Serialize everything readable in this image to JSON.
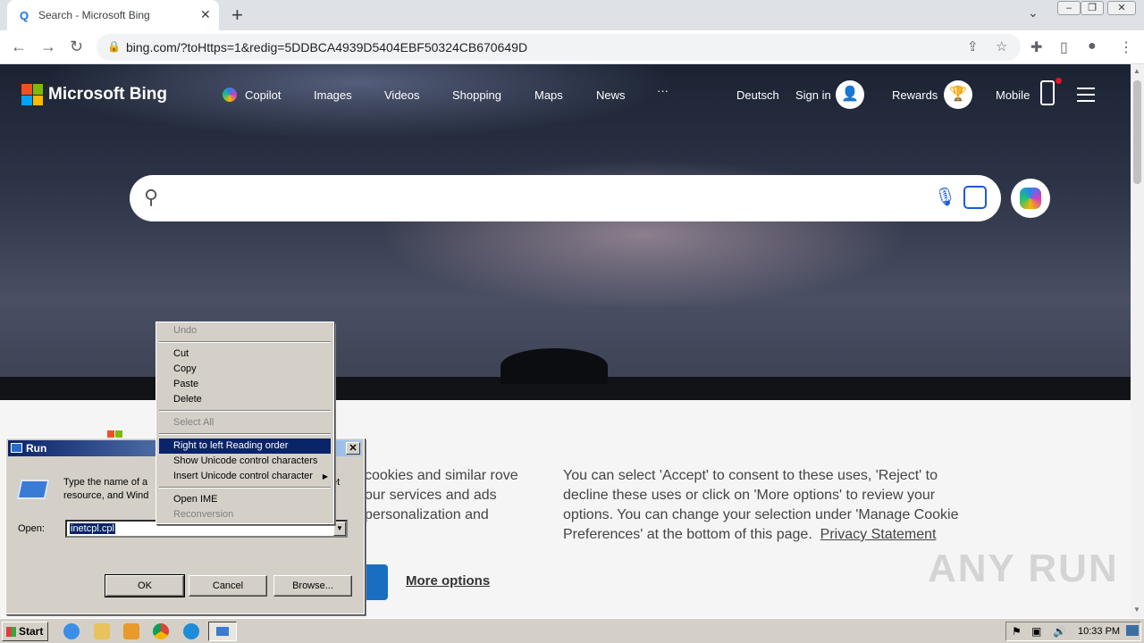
{
  "browser": {
    "tab_title": "Search - Microsoft Bing",
    "url": "bing.com/?toHttps=1&redig=5DDBCA4939D5404EBF50324CB670649D"
  },
  "bing": {
    "logo_text": "Microsoft Bing",
    "nav": [
      "Copilot",
      "Images",
      "Videos",
      "Shopping",
      "Maps",
      "News",
      "···"
    ],
    "language": "Deutsch",
    "sign_in": "Sign in",
    "rewards": "Rewards",
    "mobile": "Mobile"
  },
  "cookie": {
    "text_left": "cookies and similar rove our services and ads personalization and",
    "text_right": "You can select 'Accept' to consent to these uses, 'Reject' to decline these uses or click on 'More options' to review your options. You can change your selection under 'Manage Cookie Preferences' at the bottom of this page.",
    "privacy_link": "Privacy Statement",
    "more_options": "More options"
  },
  "run_dialog": {
    "title": "Run",
    "description_line1": "Type the name of a",
    "description_tail1": "et",
    "description_line2": "resource, and Wind",
    "open_label": "Open:",
    "open_value": "inetcpl.cpl",
    "ok": "OK",
    "cancel": "Cancel",
    "browse": "Browse..."
  },
  "context_menu": {
    "undo": "Undo",
    "cut": "Cut",
    "copy": "Copy",
    "paste": "Paste",
    "delete": "Delete",
    "select_all": "Select All",
    "rtl": "Right to left Reading order",
    "show_unicode": "Show Unicode control characters",
    "insert_unicode": "Insert Unicode control character",
    "open_ime": "Open IME",
    "reconversion": "Reconversion"
  },
  "taskbar": {
    "start": "Start",
    "clock": "10:33 PM"
  },
  "watermark": "ANY RUN"
}
